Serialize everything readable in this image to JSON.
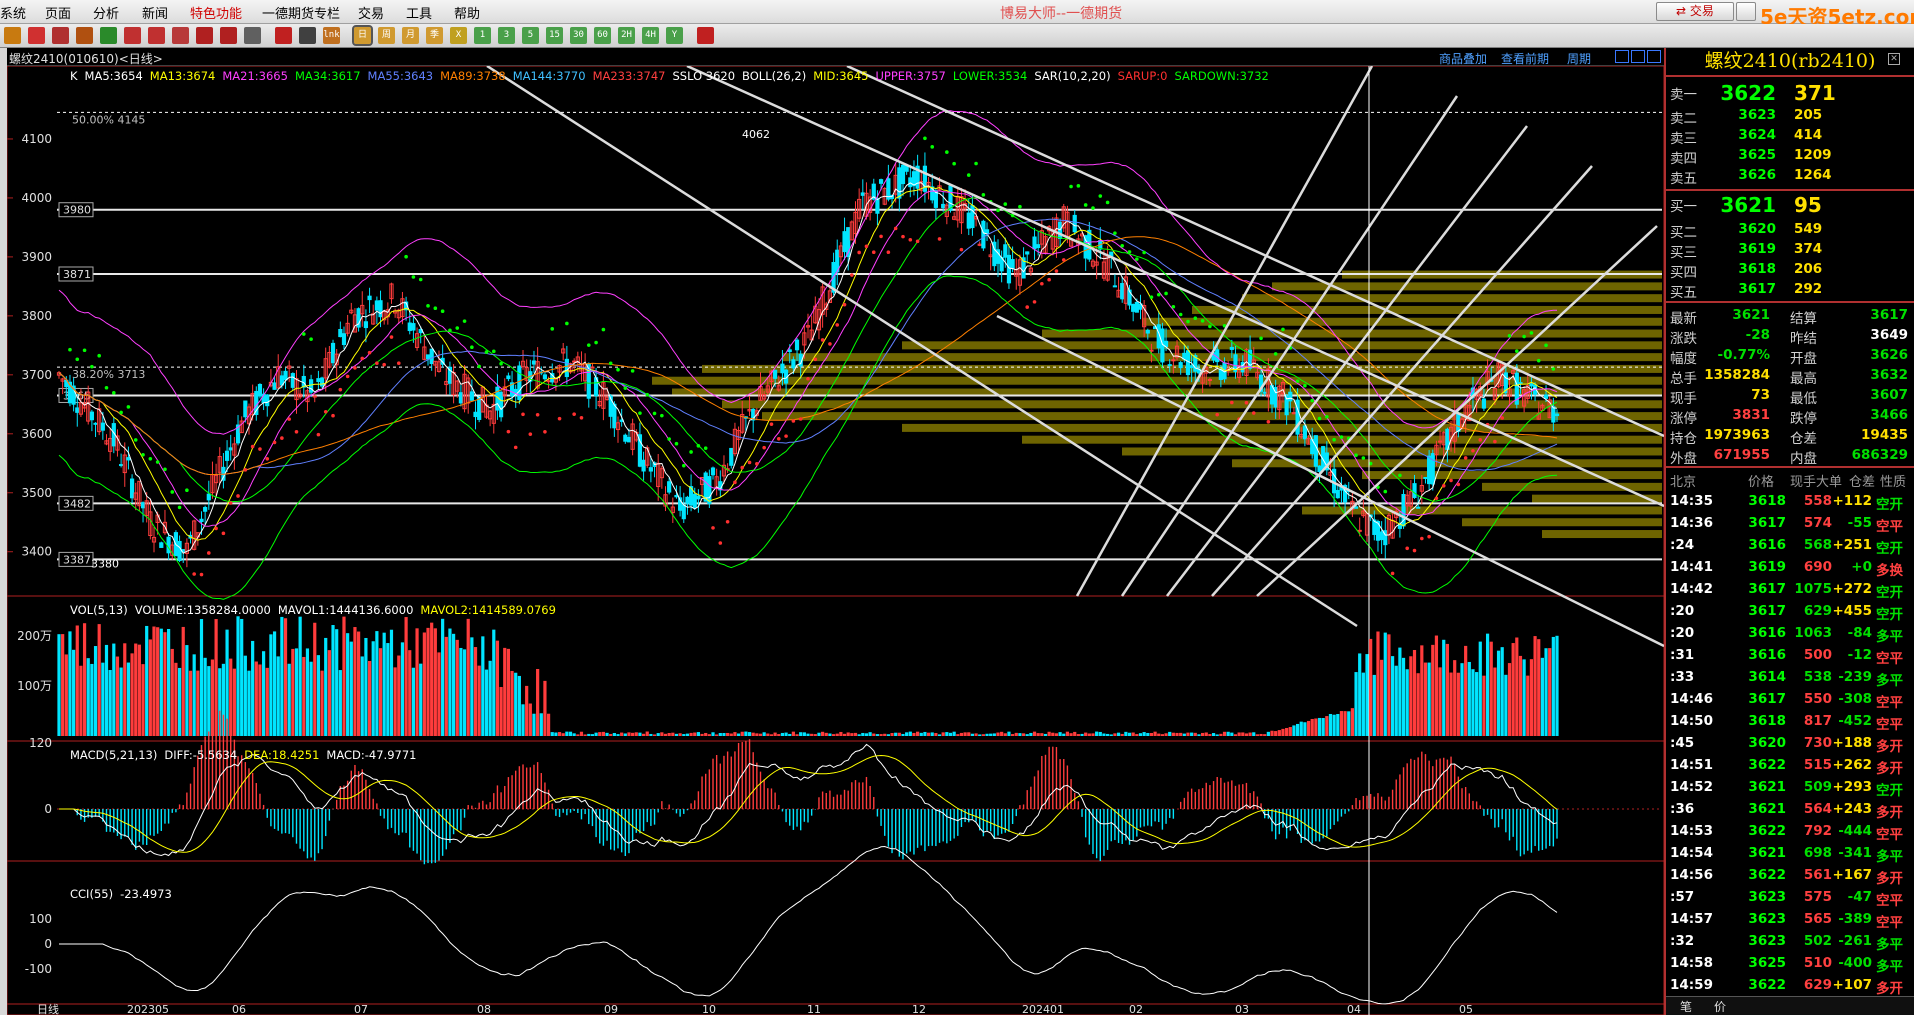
{
  "app": {
    "title": "博易大师--一德期货",
    "watermark": "5e天资5etz.com"
  },
  "menu": [
    {
      "label": "系统"
    },
    {
      "label": "页面"
    },
    {
      "label": "分析"
    },
    {
      "label": "新闻"
    },
    {
      "label": "特色功能",
      "active": true
    },
    {
      "label": "一德期货专栏"
    },
    {
      "label": "交易"
    },
    {
      "label": "工具"
    },
    {
      "label": "帮助"
    }
  ],
  "top_buttons": {
    "trade": "交易"
  },
  "toolbar_icons": [
    {
      "name": "open-icon",
      "color": "#c87a10"
    },
    {
      "name": "home-icon",
      "color": "#d03030"
    },
    {
      "name": "quote-icon",
      "color": "#b03030"
    },
    {
      "name": "report-icon",
      "color": "#b05010"
    },
    {
      "name": "refresh-icon",
      "color": "#2a8a2a"
    },
    {
      "name": "zoom-in-icon",
      "color": "#c03030"
    },
    {
      "name": "zoom-out-icon",
      "color": "#c03030"
    },
    {
      "name": "tool-icon",
      "color": "#b83a3a"
    },
    {
      "name": "filter-icon",
      "color": "#b02020"
    },
    {
      "name": "pen-icon",
      "color": "#b02020"
    },
    {
      "name": "grid-icon",
      "color": "#606060"
    },
    {
      "name": "chart-icon",
      "color": "#c02020"
    },
    {
      "name": "draw-icon",
      "color": "#404040"
    },
    {
      "name": "line-icon",
      "color": "#c07020",
      "text": "lnk"
    },
    {
      "name": "daily-icon",
      "color": "#d09a30",
      "text": "日",
      "selected": true
    },
    {
      "name": "weekly-icon",
      "color": "#d09a30",
      "text": "周"
    },
    {
      "name": "monthly-icon",
      "color": "#d09a30",
      "text": "月"
    },
    {
      "name": "quarter-icon",
      "color": "#d09a30",
      "text": "季"
    },
    {
      "name": "period-x-icon",
      "color": "#c0a020",
      "text": "X"
    },
    {
      "name": "min1-icon",
      "color": "#4aa04a",
      "text": "1"
    },
    {
      "name": "min3-icon",
      "color": "#4aa04a",
      "text": "3"
    },
    {
      "name": "min5-icon",
      "color": "#4aa04a",
      "text": "5"
    },
    {
      "name": "min15-icon",
      "color": "#4aa04a",
      "text": "15"
    },
    {
      "name": "min30-icon",
      "color": "#4aa04a",
      "text": "30"
    },
    {
      "name": "min60-icon",
      "color": "#4aa04a",
      "text": "60"
    },
    {
      "name": "hour2-icon",
      "color": "#4aa04a",
      "text": "2H"
    },
    {
      "name": "hour4-icon",
      "color": "#4aa04a",
      "text": "4H"
    },
    {
      "name": "year-icon",
      "color": "#4aa04a",
      "text": "Y"
    },
    {
      "name": "calc-icon",
      "color": "#c02020"
    }
  ],
  "chart": {
    "title": "螺纹2410(010610)<日线>",
    "links": {
      "add": "商品叠加",
      "history": "查看前期",
      "cycle": "周期"
    },
    "price_indicator_line": [
      {
        "t": "K",
        "c": "#ffffff"
      },
      {
        "t": "MA5:3654",
        "c": "#ffffff"
      },
      {
        "t": "MA13:3674",
        "c": "#ffff00"
      },
      {
        "t": "MA21:3665",
        "c": "#ff40ff"
      },
      {
        "t": "MA34:3617",
        "c": "#00ff00"
      },
      {
        "t": "MA55:3643",
        "c": "#6080ff"
      },
      {
        "t": "MA89:3738",
        "c": "#ff8000"
      },
      {
        "t": "MA144:3770",
        "c": "#40c0ff"
      },
      {
        "t": "MA233:3747",
        "c": "#ff4040"
      },
      {
        "t": "SSLO 3620",
        "c": "#ffffff"
      },
      {
        "t": "BOLL(26,2)",
        "c": "#ffffff"
      },
      {
        "t": "MID:3645",
        "c": "#ffff00"
      },
      {
        "t": "UPPER:3757",
        "c": "#ff40ff"
      },
      {
        "t": "LOWER:3534",
        "c": "#00ff00"
      },
      {
        "t": "SAR(10,2,20)",
        "c": "#ffffff"
      },
      {
        "t": "SARUP:0",
        "c": "#ff3030"
      },
      {
        "t": "SARDOWN:3732",
        "c": "#00ff00"
      }
    ],
    "price_axis": [
      "4100",
      "4000",
      "3900",
      "3800",
      "3700",
      "3600",
      "3500",
      "3400"
    ],
    "price_marks": [
      {
        "label": "3980",
        "value": 3980
      },
      {
        "label": "3871",
        "value": 3871
      },
      {
        "label": "3665",
        "value": 3665
      },
      {
        "label": "3482",
        "value": 3482
      },
      {
        "label": "3387",
        "value": 3387
      }
    ],
    "annotations": {
      "fib": "50.00% 4145",
      "fib_value": 4145,
      "fib2": "38.20% 3713",
      "fib2_value": 3713,
      "high": "4062",
      "high_value": 4062,
      "low": "3380",
      "low_value": 3380
    },
    "vol_indicator_line": [
      {
        "t": "VOL(5,13)",
        "c": "#ffffff"
      },
      {
        "t": "VOLUME:1358284.0000",
        "c": "#ffffff"
      },
      {
        "t": "MAVOL1:1444136.6000",
        "c": "#ffffff"
      },
      {
        "t": "MAVOL2:1414589.0769",
        "c": "#ffff00"
      }
    ],
    "vol_axis": [
      "200万",
      "100万"
    ],
    "macd_indicator_line": [
      {
        "t": "MACD(5,21,13)",
        "c": "#ffffff"
      },
      {
        "t": "DIFF:-5.5634",
        "c": "#ffffff"
      },
      {
        "t": "DEA:18.4251",
        "c": "#ffff00"
      },
      {
        "t": "MACD:-47.9771",
        "c": "#ffffff"
      }
    ],
    "macd_axis": [
      "120",
      "0"
    ],
    "cci_indicator_line": [
      {
        "t": "CCI(55)",
        "c": "#ffffff"
      },
      {
        "t": "-23.4973",
        "c": "#ffffff"
      }
    ],
    "cci_axis": [
      "100",
      "0",
      "-100"
    ],
    "time_axis": [
      "日线",
      "202305",
      "06",
      "07",
      "08",
      "09",
      "10",
      "11",
      "12",
      "202401",
      "02",
      "03",
      "04",
      "05"
    ],
    "colors": {
      "up": "#ff3c3c",
      "down": "#00e5ff",
      "vol_bar": "#ff3c3c"
    }
  },
  "quote": {
    "title": "螺纹2410(rb2410)",
    "asks": [
      {
        "label": "卖五",
        "price": "3626",
        "vol": "1264"
      },
      {
        "label": "卖四",
        "price": "3625",
        "vol": "1209"
      },
      {
        "label": "卖三",
        "price": "3624",
        "vol": "414"
      },
      {
        "label": "卖二",
        "price": "3623",
        "vol": "205"
      },
      {
        "label": "卖一",
        "price": "3622",
        "vol": "371"
      }
    ],
    "bids": [
      {
        "label": "买一",
        "price": "3621",
        "vol": "95"
      },
      {
        "label": "买二",
        "price": "3620",
        "vol": "549"
      },
      {
        "label": "买三",
        "price": "3619",
        "vol": "374"
      },
      {
        "label": "买四",
        "price": "3618",
        "vol": "206"
      },
      {
        "label": "买五",
        "price": "3617",
        "vol": "292"
      }
    ],
    "stats": [
      {
        "l1": "最新",
        "v1": "3621",
        "c1": "grn",
        "l2": "结算",
        "v2": "3617",
        "c2": "grn"
      },
      {
        "l1": "涨跌",
        "v1": "-28",
        "c1": "grn",
        "l2": "昨结",
        "v2": "3649",
        "c2": "wht"
      },
      {
        "l1": "幅度",
        "v1": "-0.77%",
        "c1": "grn",
        "l2": "开盘",
        "v2": "3626",
        "c2": "grn"
      },
      {
        "l1": "总手",
        "v1": "1358284",
        "c1": "yel",
        "l2": "最高",
        "v2": "3632",
        "c2": "grn"
      },
      {
        "l1": "现手",
        "v1": "73",
        "c1": "yel",
        "l2": "最低",
        "v2": "3607",
        "c2": "grn"
      },
      {
        "l1": "涨停",
        "v1": "3831",
        "c1": "red",
        "l2": "跌停",
        "v2": "3466",
        "c2": "grn"
      },
      {
        "l1": "持仓",
        "v1": "1973963",
        "c1": "yel",
        "l2": "仓差",
        "v2": "19435",
        "c2": "yel"
      },
      {
        "l1": "外盘",
        "v1": "671955",
        "c1": "red",
        "l2": "内盘",
        "v2": "686329",
        "c2": "grn"
      }
    ],
    "ticks_header": {
      "place": "北京",
      "price": "价格",
      "vol": "现手",
      "large": "大单",
      "diff": "仓差",
      "nature": "性质"
    },
    "ticks": [
      {
        "t": "14:35",
        "p": "3618",
        "v": "558",
        "d": "+112",
        "n": "空开",
        "nc": "grn",
        "vc": "red",
        "dc": "yel"
      },
      {
        "t": "14:36",
        "p": "3617",
        "v": "574",
        "d": "-55",
        "n": "空平",
        "nc": "red",
        "vc": "red",
        "dc": "grn"
      },
      {
        "t": ":24",
        "p": "3616",
        "v": "568",
        "d": "+251",
        "n": "空开",
        "nc": "grn",
        "vc": "grn",
        "dc": "yel"
      },
      {
        "t": "14:41",
        "p": "3619",
        "v": "690",
        "d": "+0",
        "n": "多换",
        "nc": "red",
        "vc": "red",
        "dc": "grn"
      },
      {
        "t": "14:42",
        "p": "3617",
        "v": "1075",
        "d": "+272",
        "n": "空开",
        "nc": "grn",
        "vc": "grn",
        "dc": "yel"
      },
      {
        "t": ":20",
        "p": "3617",
        "v": "629",
        "d": "+455",
        "n": "空开",
        "nc": "grn",
        "vc": "grn",
        "dc": "yel"
      },
      {
        "t": ":20",
        "p": "3616",
        "v": "1063",
        "d": "-84",
        "n": "多平",
        "nc": "grn",
        "vc": "grn",
        "dc": "grn"
      },
      {
        "t": ":31",
        "p": "3616",
        "v": "500",
        "d": "-12",
        "n": "空平",
        "nc": "red",
        "vc": "red",
        "dc": "grn"
      },
      {
        "t": ":33",
        "p": "3614",
        "v": "538",
        "d": "-239",
        "n": "多平",
        "nc": "grn",
        "vc": "grn",
        "dc": "grn"
      },
      {
        "t": "14:46",
        "p": "3617",
        "v": "550",
        "d": "-308",
        "n": "空平",
        "nc": "red",
        "vc": "red",
        "dc": "grn"
      },
      {
        "t": "14:50",
        "p": "3618",
        "v": "817",
        "d": "-452",
        "n": "空平",
        "nc": "red",
        "vc": "red",
        "dc": "grn"
      },
      {
        "t": ":45",
        "p": "3620",
        "v": "730",
        "d": "+188",
        "n": "多开",
        "nc": "red",
        "vc": "red",
        "dc": "yel"
      },
      {
        "t": "14:51",
        "p": "3622",
        "v": "515",
        "d": "+262",
        "n": "多开",
        "nc": "red",
        "vc": "red",
        "dc": "yel"
      },
      {
        "t": "14:52",
        "p": "3621",
        "v": "509",
        "d": "+293",
        "n": "空开",
        "nc": "grn",
        "vc": "grn",
        "dc": "yel"
      },
      {
        "t": ":36",
        "p": "3621",
        "v": "564",
        "d": "+243",
        "n": "多开",
        "nc": "red",
        "vc": "red",
        "dc": "yel"
      },
      {
        "t": "14:53",
        "p": "3622",
        "v": "792",
        "d": "-444",
        "n": "空平",
        "nc": "red",
        "vc": "red",
        "dc": "grn"
      },
      {
        "t": "14:54",
        "p": "3621",
        "v": "698",
        "d": "-341",
        "n": "多平",
        "nc": "grn",
        "vc": "grn",
        "dc": "grn"
      },
      {
        "t": "14:56",
        "p": "3622",
        "v": "561",
        "d": "+167",
        "n": "多开",
        "nc": "red",
        "vc": "red",
        "dc": "yel"
      },
      {
        "t": ":57",
        "p": "3623",
        "v": "575",
        "d": "-47",
        "n": "空平",
        "nc": "red",
        "vc": "red",
        "dc": "grn"
      },
      {
        "t": "14:57",
        "p": "3623",
        "v": "565",
        "d": "-389",
        "n": "空平",
        "nc": "red",
        "vc": "red",
        "dc": "grn"
      },
      {
        "t": ":32",
        "p": "3623",
        "v": "502",
        "d": "-261",
        "n": "多平",
        "nc": "grn",
        "vc": "grn",
        "dc": "grn"
      },
      {
        "t": "14:58",
        "p": "3625",
        "v": "510",
        "d": "-400",
        "n": "多平",
        "nc": "grn",
        "vc": "red",
        "dc": "grn"
      },
      {
        "t": "14:59",
        "p": "3622",
        "v": "629",
        "d": "+107",
        "n": "多开",
        "nc": "red",
        "vc": "red",
        "dc": "yel"
      }
    ],
    "foot_tabs": [
      "笔",
      "价"
    ]
  }
}
